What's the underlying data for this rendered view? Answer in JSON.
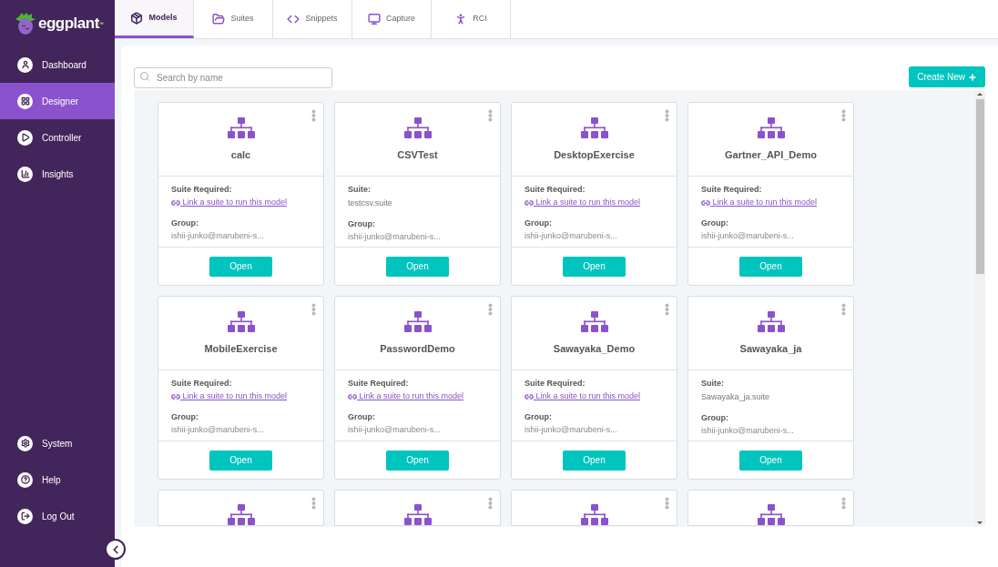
{
  "logo": {
    "text": "eggplant",
    "mark": "™"
  },
  "nav_top": [
    {
      "label": "Dashboard",
      "selected": false
    },
    {
      "label": "Designer",
      "selected": true
    },
    {
      "label": "Controller",
      "selected": false
    },
    {
      "label": "Insights",
      "selected": false
    }
  ],
  "nav_bottom": [
    {
      "label": "System",
      "selected": false
    },
    {
      "label": "Help",
      "selected": false
    },
    {
      "label": "Log Out",
      "selected": false
    }
  ],
  "tabs": [
    {
      "label": "Models",
      "selected": true
    },
    {
      "label": "Suites",
      "selected": false
    },
    {
      "label": "Snippets",
      "selected": false
    },
    {
      "label": "Capture",
      "selected": false
    },
    {
      "label": "RCI",
      "selected": false
    }
  ],
  "search": {
    "placeholder": "Search by name"
  },
  "create_button": {
    "label": "Create New"
  },
  "models": [
    {
      "kind": "unlinked",
      "name": "calc",
      "suite_label": "Suite Required:",
      "suite_value": " Link a suite to run this model",
      "group_label": "Group:",
      "group_value": "ishii-junko@marubeni-s...",
      "button": "Open"
    },
    {
      "kind": "linked",
      "name": "CSVTest",
      "suite_label": "Suite:",
      "suite_value": "testcsv.suite",
      "group_label": "Group:",
      "group_value": "ishii-junko@marubeni-s...",
      "button": "Open"
    },
    {
      "kind": "unlinked",
      "name": "DesktopExercise",
      "suite_label": "Suite Required:",
      "suite_value": " Link a suite to run this model",
      "group_label": "Group:",
      "group_value": "ishii-junko@marubeni-s...",
      "button": "Open"
    },
    {
      "kind": "unlinked",
      "name": "Gartner_API_Demo",
      "suite_label": "Suite Required:",
      "suite_value": " Link a suite to run this model",
      "group_label": "Group:",
      "group_value": "ishii-junko@marubeni-s...",
      "button": "Open"
    },
    {
      "kind": "unlinked",
      "name": "MobileExercise",
      "suite_label": "Suite Required:",
      "suite_value": " Link a suite to run this model",
      "group_label": "Group:",
      "group_value": "ishii-junko@marubeni-s...",
      "button": "Open"
    },
    {
      "kind": "unlinked",
      "name": "PasswordDemo",
      "suite_label": "Suite Required:",
      "suite_value": " Link a suite to run this model",
      "group_label": "Group:",
      "group_value": "ishii-junko@marubeni-s...",
      "button": "Open"
    },
    {
      "kind": "unlinked",
      "name": "Sawayaka_Demo",
      "suite_label": "Suite Required:",
      "suite_value": " Link a suite to run this model",
      "group_label": "Group:",
      "group_value": "ishii-junko@marubeni-s...",
      "button": "Open"
    },
    {
      "kind": "linked",
      "name": "Sawayaka_ja",
      "suite_label": "Suite:",
      "suite_value": "Sawayaka_ja.suite",
      "group_label": "Group:",
      "group_value": "ishii-junko@marubeni-s...",
      "button": "Open"
    },
    {
      "kind": "cut"
    },
    {
      "kind": "cut"
    },
    {
      "kind": "cut"
    },
    {
      "kind": "cut"
    }
  ]
}
